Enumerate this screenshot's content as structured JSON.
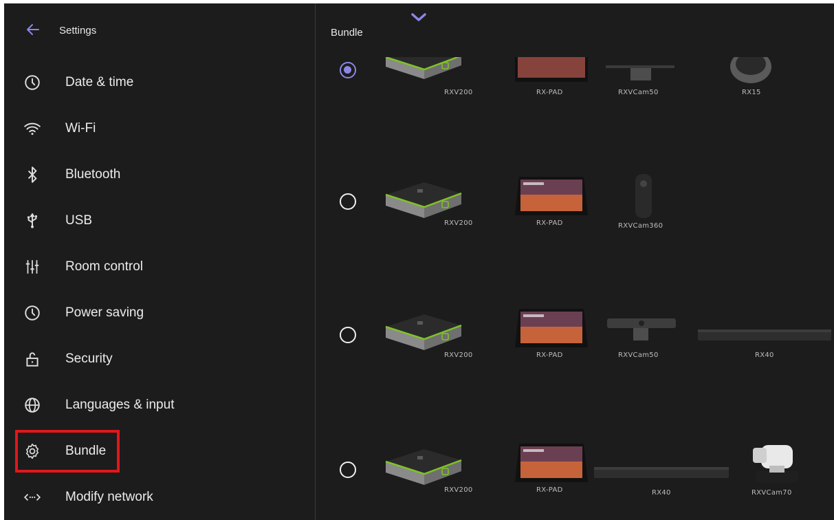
{
  "header": {
    "title": "Settings"
  },
  "sidebar": {
    "items": [
      {
        "label": "Date & time",
        "icon": "clock-icon"
      },
      {
        "label": "Wi-Fi",
        "icon": "wifi-icon"
      },
      {
        "label": "Bluetooth",
        "icon": "bluetooth-icon"
      },
      {
        "label": "USB",
        "icon": "usb-icon"
      },
      {
        "label": "Room control",
        "icon": "sliders-icon"
      },
      {
        "label": "Power saving",
        "icon": "clock-icon"
      },
      {
        "label": "Security",
        "icon": "unlock-icon"
      },
      {
        "label": "Languages & input",
        "icon": "globe-icon"
      },
      {
        "label": "Bundle",
        "icon": "gear-icon",
        "selected": true
      },
      {
        "label": "Modify network",
        "icon": "network-code-icon"
      }
    ]
  },
  "main": {
    "title": "Bundle",
    "bundles": [
      {
        "selected": true,
        "devices": [
          "RXV200",
          "RX-PAD",
          "RXVCam50",
          "RX15"
        ]
      },
      {
        "selected": false,
        "devices": [
          "RXV200",
          "RX-PAD",
          "RXVCam360"
        ]
      },
      {
        "selected": false,
        "devices": [
          "RXV200",
          "RX-PAD",
          "RXVCam50",
          "RX40"
        ]
      },
      {
        "selected": false,
        "devices": [
          "RXV200",
          "RX-PAD",
          "RX40",
          "RXVCam70"
        ]
      }
    ]
  },
  "colors": {
    "background": "#1c1c1c",
    "accent": "#8c87e6",
    "highlight": "#e3161b",
    "device_green": "#7fc326"
  }
}
